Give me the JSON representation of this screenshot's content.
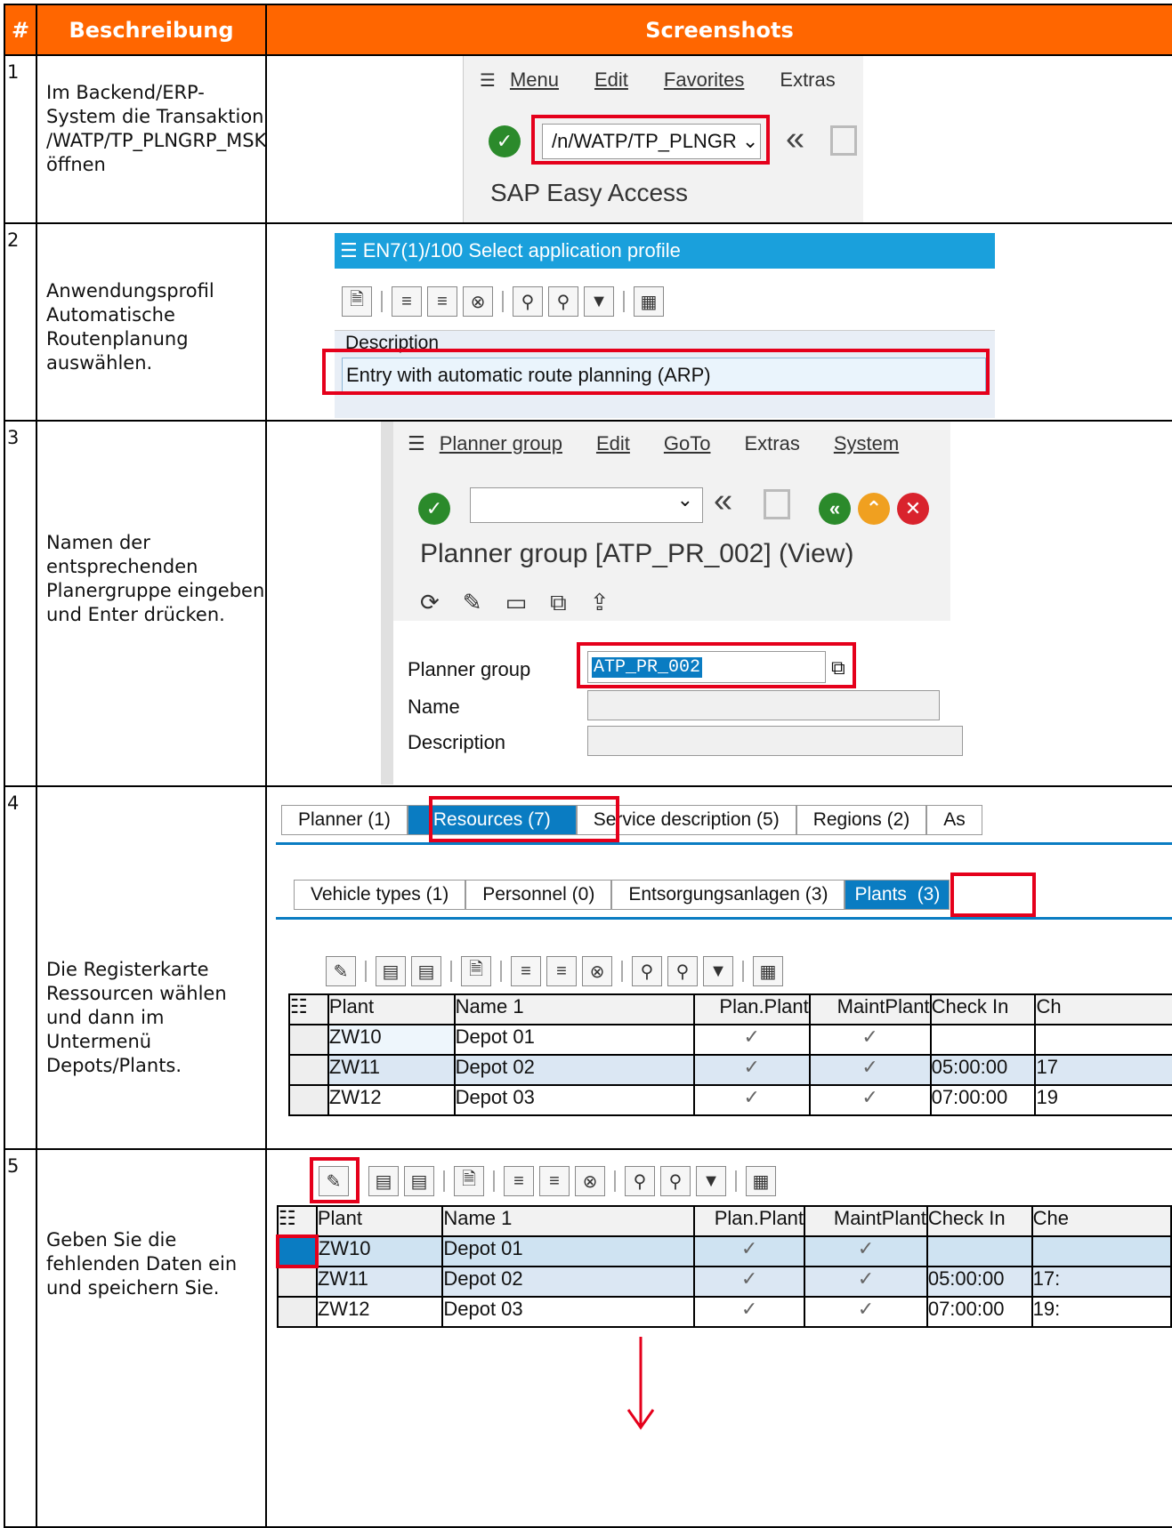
{
  "header": {
    "num": "#",
    "desc": "Beschreibung",
    "shots": "Screenshots"
  },
  "rows": [
    {
      "num": "1",
      "desc": "Im Backend/ERP-System die Transaktion /WATP/TP_PLNGRP_MSK öffnen"
    },
    {
      "num": "2",
      "desc": "Anwendungsprofil Automatische Routenplanung auswählen."
    },
    {
      "num": "3",
      "desc": "Namen der entsprechenden Planergruppe eingeben und Enter drücken."
    },
    {
      "num": "4",
      "desc": "Die Registerkarte Ressourcen wählen und dann im Untermenü Depots/Plants."
    },
    {
      "num": "5",
      "desc": "Geben Sie die fehlenden Daten ein und speichern Sie."
    }
  ],
  "shot1": {
    "menu": [
      "Menu",
      "Edit",
      "Favorites",
      "Extras"
    ],
    "command": "/n/WATP/TP_PLNGR",
    "title": "SAP Easy Access"
  },
  "shot2": {
    "window_title": "EN7(1)/100 Select application profile",
    "column": "Description",
    "entry": "Entry with automatic route planning (ARP)"
  },
  "shot3": {
    "menu": [
      "Planner group",
      "Edit",
      "GoTo",
      "Extras",
      "System"
    ],
    "title": "Planner group [ATP_PR_002] (View)",
    "labels": [
      "Planner group",
      "Name",
      "Description"
    ],
    "planner_group_value": "ATP_PR_002"
  },
  "shot4": {
    "tabs": [
      "Planner (1)",
      "Resources (7)",
      "Service description (5)",
      "Regions (2)",
      "As"
    ],
    "subtabs": [
      "Vehicle types (1)",
      "Personnel (0)",
      "Entsorgungsanlagen (3)",
      "Plants",
      "(3)"
    ],
    "columns": [
      "Plant",
      "Name 1",
      "Plan.Plant",
      "MaintPlant",
      "Check In",
      "Ch"
    ],
    "rows": [
      [
        "ZW10",
        "Depot 01",
        "",
        ""
      ],
      [
        "ZW11",
        "Depot 02",
        "05:00:00",
        "17"
      ],
      [
        "ZW12",
        "Depot 03",
        "07:00:00",
        "19"
      ]
    ]
  },
  "shot5": {
    "columns": [
      "Plant",
      "Name 1",
      "Plan.Plant",
      "MaintPlant",
      "Check In",
      "Che"
    ],
    "rows": [
      [
        "ZW10",
        "Depot 01",
        "",
        ""
      ],
      [
        "ZW11",
        "Depot 02",
        "05:00:00",
        "17:"
      ],
      [
        "ZW12",
        "Depot 03",
        "07:00:00",
        "19:"
      ]
    ]
  },
  "icons": {
    "check": "✓",
    "chevron_down": "⌄",
    "back": "«"
  },
  "colors": {
    "header": "#ff6600",
    "sap_blue": "#0a7cc2",
    "highlight": "#e5001b"
  }
}
